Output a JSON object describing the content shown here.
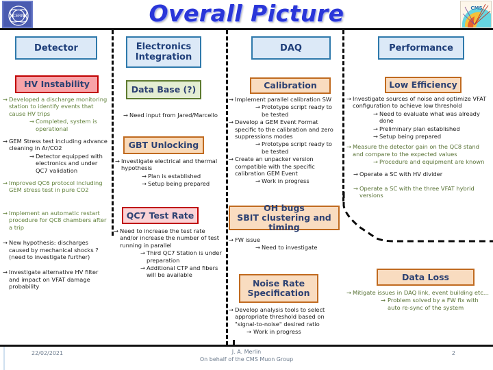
{
  "header": {
    "title": "Overall Picture",
    "cern_logo": "cern-logo",
    "cms_logo": "cms-logo"
  },
  "columns": [
    {
      "id": "detector",
      "label": "Detector"
    },
    {
      "id": "electronics",
      "label": "Electronics\nIntegration"
    },
    {
      "id": "daq",
      "label": "DAQ"
    },
    {
      "id": "performance",
      "label": "Performance"
    }
  ],
  "topics": {
    "hv_instability": "HV Instability",
    "data_base": "Data Base (?)",
    "gbt_unlocking": "GBT Unlocking",
    "qc7_test_rate": "QC7 Test Rate",
    "calibration": "Calibration",
    "oh_bugs": "OH bugs\nSBIT clustering and timing",
    "noise_rate": "Noise Rate\nSpecification",
    "low_efficiency": "Low Efficiency",
    "data_loss": "Data Loss"
  },
  "bullets": {
    "hv_instability": [
      {
        "level": 1,
        "color": "green",
        "text": "Developed a discharge monitoring station to identify events that cause HV trips"
      },
      {
        "level": 2,
        "color": "green",
        "text": "Completed, system is operational"
      },
      {
        "level": 1,
        "color": "black",
        "text": "GEM Stress test including advance cleaning in Ar/CO2"
      },
      {
        "level": 2,
        "color": "black",
        "text": "Detector equipped with electronics and under QC7 validation"
      },
      {
        "level": 1,
        "color": "green",
        "text": "Improved QC6 protocol including GEM stress test in pure CO2"
      },
      {
        "level": 1,
        "color": "green",
        "text": "Implement an automatic restart procedure for QC8 chambers after a trip"
      },
      {
        "level": 1,
        "color": "black",
        "text": "New hypothesis: discharges caused by mechanical shocks ? (need to investigate further)"
      },
      {
        "level": 1,
        "color": "black",
        "text": "Investigate alternative HV filter and impact on VFAT damage probability"
      }
    ],
    "data_base": [
      {
        "level": 1,
        "color": "black",
        "text": "Need input from Jared/Marcello"
      }
    ],
    "gbt_unlocking": [
      {
        "level": 1,
        "color": "black",
        "text": "Investigate electrical and thermal hypothesis"
      },
      {
        "level": 2,
        "color": "black",
        "text": "Plan is established"
      },
      {
        "level": 2,
        "color": "black",
        "text": "Setup being prepared"
      }
    ],
    "qc7_test_rate": [
      {
        "level": 1,
        "color": "black",
        "text": "Need to increase the test rate and/or increase the number of test running in parallel"
      },
      {
        "level": 2,
        "color": "black",
        "text": "Third QC7 Station is under preparation"
      },
      {
        "level": 2,
        "color": "black",
        "text": "Additional CTP and fibers will be available"
      }
    ],
    "calibration": [
      {
        "level": 1,
        "color": "black",
        "text": "Implement parallel calibration SW"
      },
      {
        "level": 2,
        "color": "black",
        "text": "Prototype script ready to be tested"
      },
      {
        "level": 1,
        "color": "black",
        "text": "Develop a GEM Event Format specific to the calibration and zero suppressions modes"
      },
      {
        "level": 2,
        "color": "black",
        "text": "Prototype script ready to be tested"
      },
      {
        "level": 1,
        "color": "black",
        "text": "Create an unpacker version compatible with the specific calibration GEM Event"
      },
      {
        "level": 2,
        "color": "black",
        "text": "Work in progress"
      }
    ],
    "oh_bugs": [
      {
        "level": 1,
        "color": "black",
        "text": "FW issue"
      },
      {
        "level": 2,
        "color": "black",
        "text": "Need to investigate"
      }
    ],
    "noise_rate": [
      {
        "level": 1,
        "color": "black",
        "text": "Develop analysis tools to select appropriate threshold based on \"signal-to-noise\" desired ratio"
      },
      {
        "level": 2,
        "color": "black",
        "text": "Work in progress"
      }
    ],
    "low_efficiency": [
      {
        "level": 1,
        "color": "black",
        "text": "Investigate sources of noise and optimize VFAT configuration to achieve low threshold"
      },
      {
        "level": 2,
        "color": "black",
        "text": "Need to evaluate what was already done"
      },
      {
        "level": 2,
        "color": "black",
        "text": "Preliminary plan established"
      },
      {
        "level": 2,
        "color": "black",
        "text": "Setup being prepared"
      },
      {
        "level": 1,
        "color": "green",
        "text": "Measure the detector gain on the QC8 stand and compare to the expected values"
      },
      {
        "level": 2,
        "color": "green",
        "text": "Procedure and equipment are known"
      },
      {
        "level": 1,
        "color": "black",
        "text": "Operate a SC with HV divider"
      },
      {
        "level": 1,
        "color": "green",
        "text": "Operate a SC with the three VFAT hybrid versions"
      }
    ],
    "data_loss": [
      {
        "level": 1,
        "color": "green",
        "text": "Mitigate issues in DAQ link, event building etc…"
      },
      {
        "level": 2,
        "color": "green",
        "text": "Problem solved by a FW fix with auto re-sync of the system"
      }
    ]
  },
  "footer": {
    "date": "22/02/2021",
    "author": "J. A. Merlin",
    "affiliation": "On behalf of the CMS Muon Group",
    "page": "2"
  },
  "colors": {
    "title_blue": "#2a36d8",
    "head_fill": "#dce9f7",
    "head_border": "#2e79ab",
    "head_text": "#1f3f7a",
    "red_fill": "#f8a3a8",
    "red_border": "#c00000",
    "green_fill": "#e4eed3",
    "green_border": "#5d7a2e",
    "orange_fill": "#f9d9b8",
    "orange_border": "#c06a1f",
    "pink_fill": "#fbd3d6",
    "bullet_green": "#60803a",
    "bullet_black": "#1a1a1a"
  }
}
